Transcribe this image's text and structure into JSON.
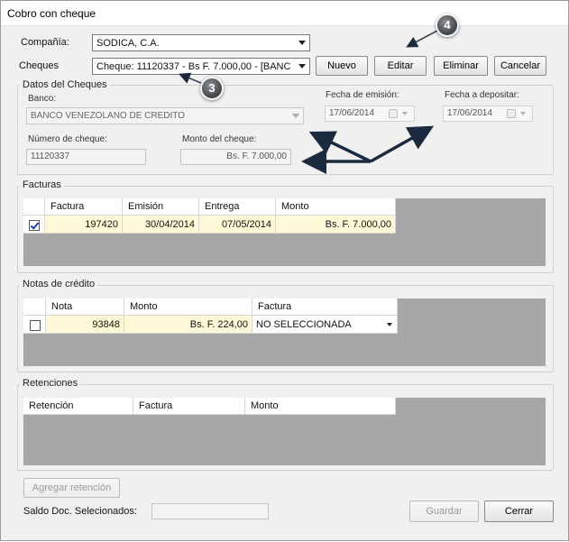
{
  "window": {
    "title": "Cobro con cheque"
  },
  "company": {
    "label": "Compañía:",
    "value": "SODICA, C.A."
  },
  "cheques": {
    "label": "Cheques",
    "value": "Cheque: 11120337 - Bs F. 7.000,00 - [BANC"
  },
  "buttons": {
    "nuevo": "Nuevo",
    "editar": "Editar",
    "eliminar": "Eliminar",
    "cancelar": "Cancelar"
  },
  "check_data": {
    "title": "Datos del Cheques",
    "bank_label": "Banco:",
    "bank_value": "BANCO VENEZOLANO DE CREDITO",
    "issue_date_label": "Fecha de emisión:",
    "issue_date_value": "17/06/2014",
    "deposit_date_label": "Fecha a depositar:",
    "deposit_date_value": "17/06/2014",
    "number_label": "Número de cheque:",
    "number_value": "11120337",
    "amount_label": "Monto del cheque:",
    "amount_value": "Bs. F. 7.000,00"
  },
  "facturas": {
    "title": "Facturas",
    "columns": [
      "Factura",
      "Emisión",
      "Entrega",
      "Monto"
    ],
    "rows": [
      {
        "checked": true,
        "factura": "197420",
        "emision": "30/04/2014",
        "entrega": "07/05/2014",
        "monto": "Bs. F. 7.000,00"
      }
    ]
  },
  "notas": {
    "title": "Notas de crédito",
    "columns": [
      "Nota",
      "Monto",
      "Factura"
    ],
    "rows": [
      {
        "checked": false,
        "nota": "93848",
        "monto": "Bs. F. 224,00",
        "factura": "NO SELECCIONADA"
      }
    ]
  },
  "retenciones": {
    "title": "Retenciones",
    "columns": [
      "Retención",
      "Factura",
      "Monto"
    ]
  },
  "footer": {
    "agregar_retencion": "Agregar retención",
    "saldo_label": "Saldo Doc. Selecionados:",
    "saldo_value": "",
    "guardar": "Guardar",
    "cerrar": "Cerrar"
  },
  "annotations": {
    "badge_3": "3",
    "badge_4": "4",
    "arrow_color": "#1b2a3e"
  }
}
